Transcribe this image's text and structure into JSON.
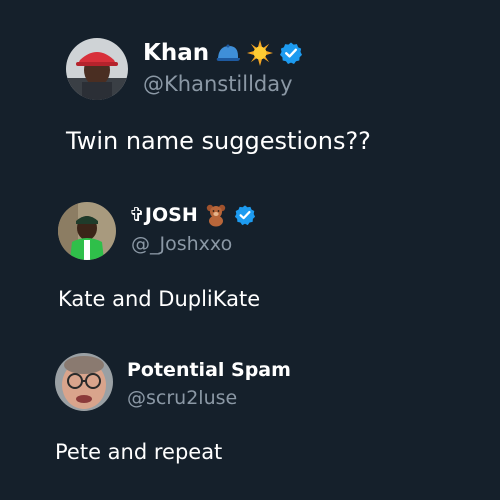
{
  "colors": {
    "background": "#15202b",
    "text_primary": "#ffffff",
    "text_secondary": "#8b98a5",
    "verified": "#1d9bf0"
  },
  "tweets": [
    {
      "name": "Khan",
      "handle": "@Khanstillday",
      "text": "Twin name suggestions??",
      "icons": [
        "blue-cap-emoji-icon",
        "sun-emoji-icon",
        "verified-badge-icon"
      ]
    },
    {
      "name": "✞JOSH",
      "handle": "@_Joshxxo",
      "text": "Kate and DupliKate",
      "icons": [
        "teddy-bear-emoji-icon",
        "verified-badge-icon"
      ]
    },
    {
      "name": "Potential Spam",
      "handle": "@scru2luse",
      "text": "Pete and repeat",
      "icons": []
    }
  ]
}
